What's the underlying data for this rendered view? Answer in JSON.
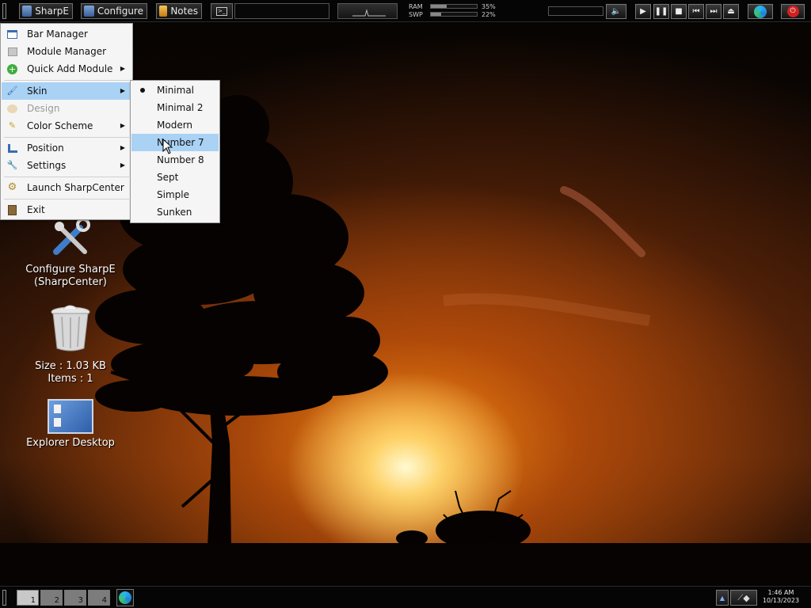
{
  "topbar": {
    "sharpe_label": "SharpE",
    "configure_label": "Configure",
    "notes_label": "Notes",
    "ram_label": "RAM",
    "swp_label": "SWP",
    "ram_percent": "35%",
    "swp_percent": "22%",
    "ram_fraction": 0.35,
    "swp_fraction": 0.22
  },
  "desktop": {
    "configure_label_1": "Configure SharpE",
    "configure_label_2": "(SharpCenter)",
    "recycle_size": "Size : 1.03 KB",
    "recycle_items": "Items : 1",
    "explorer_label": "Explorer Desktop"
  },
  "main_menu": {
    "items": [
      {
        "label": "Bar Manager",
        "icon": "bar-manager-icon"
      },
      {
        "label": "Module Manager",
        "icon": "module-manager-icon"
      },
      {
        "label": "Quick Add Module",
        "icon": "plus-icon"
      },
      {
        "label": "Skin",
        "icon": "brush-icon"
      },
      {
        "label": "Design",
        "icon": "palette-icon"
      },
      {
        "label": "Color Scheme",
        "icon": "pencil-icon"
      },
      {
        "label": "Position",
        "icon": "position-icon"
      },
      {
        "label": "Settings",
        "icon": "wrench-icon"
      },
      {
        "label": "Launch SharpCenter",
        "icon": "gear-icon"
      },
      {
        "label": "Exit",
        "icon": "exit-door-icon"
      }
    ]
  },
  "skin_menu": {
    "items": [
      "Minimal",
      "Minimal 2",
      "Modern",
      "Number 7",
      "Number 8",
      "Sept",
      "Simple",
      "Sunken"
    ],
    "checked": "Minimal",
    "highlighted": "Number 7"
  },
  "taskbar": {
    "workspaces": [
      "1",
      "2",
      "3",
      "4"
    ],
    "time": "1:46 AM",
    "date": "10/13/2023"
  },
  "colors": {
    "menu_highlight": "#a9d2f5",
    "bar_background": "#050505"
  }
}
